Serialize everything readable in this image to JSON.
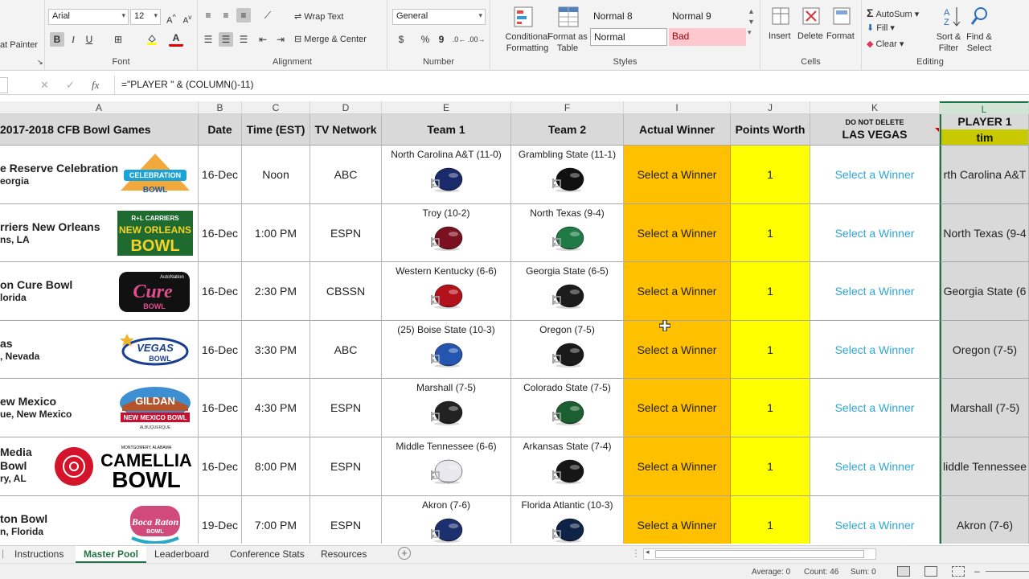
{
  "ribbon": {
    "clipboard": {
      "format_painter": "at Painter"
    },
    "font": {
      "name": "Arial",
      "size": "12",
      "group_label": "Font",
      "bold": "B",
      "italic": "I",
      "underline": "U",
      "font_color_letter": "A"
    },
    "alignment": {
      "wrap_text": "Wrap Text",
      "merge_center": "Merge & Center",
      "group_label": "Alignment"
    },
    "number": {
      "format": "General",
      "currency": "$",
      "percent": "%",
      "comma": "9",
      "group_label": "Number"
    },
    "styles": {
      "conditional_formatting": "Conditional Formatting",
      "format_as_table": "Format as Table",
      "cells": [
        "Normal 8",
        "Normal 9",
        "Normal",
        "Bad"
      ],
      "group_label": "Styles"
    },
    "cells": {
      "insert": "Insert",
      "delete": "Delete",
      "format": "Format",
      "group_label": "Cells"
    },
    "editing": {
      "autosum": "AutoSum",
      "fill": "Fill",
      "clear": "Clear",
      "sort_filter": "Sort & Filter",
      "find_select": "Find & Select",
      "group_label": "Editing"
    }
  },
  "formula_bar": {
    "fx": "fx",
    "formula": "=\"PLAYER \" & (COLUMN()-11)"
  },
  "columns": [
    "A",
    "B",
    "C",
    "D",
    "E",
    "F",
    "I",
    "J",
    "K",
    "L"
  ],
  "header": {
    "a": "2017-2018 CFB Bowl Games",
    "b": "Date",
    "c": "Time (EST)",
    "d": "TV Network",
    "e": "Team 1",
    "f": "Team 2",
    "i": "Actual Winner",
    "j": "Points Worth",
    "k_small": "DO NOT DELETE",
    "k": "LAS VEGAS",
    "l": "PLAYER 1",
    "l_sub": "tim"
  },
  "rows": [
    {
      "bowl": "e Reserve Celebration",
      "bowl2": "",
      "loc": "eorgia",
      "date": "16-Dec",
      "time": "Noon",
      "tv": "ABC",
      "team1": "North Carolina A&T (11-0)",
      "team2": "Grambling State (11-1)",
      "winner": "Select a Winner",
      "points": "1",
      "vegas": "Select a Winner",
      "player": "rth Carolina A&T"
    },
    {
      "bowl": "rriers New Orleans",
      "bowl2": "",
      "loc": "ns, LA",
      "date": "16-Dec",
      "time": "1:00 PM",
      "tv": "ESPN",
      "team1": "Troy (10-2)",
      "team2": "North Texas (9-4)",
      "winner": "Select a Winner",
      "points": "1",
      "vegas": "Select a Winner",
      "player": "North Texas (9-4"
    },
    {
      "bowl": "on Cure Bowl",
      "bowl2": "",
      "loc": "lorida",
      "date": "16-Dec",
      "time": "2:30 PM",
      "tv": "CBSSN",
      "team1": "Western Kentucky (6-6)",
      "team2": "Georgia State (6-5)",
      "winner": "Select a Winner",
      "points": "1",
      "vegas": "Select a Winner",
      "player": "Georgia State (6"
    },
    {
      "bowl": "as",
      "bowl2": "",
      "loc": ", Nevada",
      "date": "16-Dec",
      "time": "3:30 PM",
      "tv": "ABC",
      "team1": "(25) Boise State (10-3)",
      "team2": "Oregon (7-5)",
      "winner": "Select a Winner",
      "points": "1",
      "vegas": "Select a Winner",
      "player": "Oregon (7-5)"
    },
    {
      "bowl": "ew Mexico",
      "bowl2": "",
      "loc": "ue, New Mexico",
      "date": "16-Dec",
      "time": "4:30 PM",
      "tv": "ESPN",
      "team1": "Marshall (7-5)",
      "team2": "Colorado State (7-5)",
      "winner": "Select a Winner",
      "points": "1",
      "vegas": "Select a Winner",
      "player": "Marshall (7-5)"
    },
    {
      "bowl": "Media",
      "bowl2": "Bowl",
      "loc": "ry, AL",
      "date": "16-Dec",
      "time": "8:00 PM",
      "tv": "ESPN",
      "team1": "Middle Tennessee (6-6)",
      "team2": "Arkansas State (7-4)",
      "winner": "Select a Winner",
      "points": "1",
      "vegas": "Select a Winner",
      "player": "liddle Tennessee"
    },
    {
      "bowl": "ton Bowl",
      "bowl2": "",
      "loc": "n, Florida",
      "date": "19-Dec",
      "time": "7:00 PM",
      "tv": "ESPN",
      "team1": "Akron (7-6)",
      "team2": "Florida Atlantic (10-3)",
      "winner": "Select a Winner",
      "points": "1",
      "vegas": "Select a Winner",
      "player": "Akron (7-6)"
    }
  ],
  "logos": [
    {
      "text1": "CELEBRATION",
      "text2": "BOWL"
    },
    {
      "text1": "R+L CARRIERS",
      "text2": "NEW ORLEANS",
      "text3": "BOWL"
    },
    {
      "text1": "AutoNation",
      "text2": "Cure",
      "text3": "BOWL"
    },
    {
      "text1": "VEGAS",
      "text2": "BOWL"
    },
    {
      "text1": "GILDAN",
      "text2": "NEW MEXICO BOWL",
      "text3": "ALBUQUERQUE"
    },
    {
      "text1": "MONTGOMERY, ALABAMA",
      "text2": "CAMELLIA",
      "text3": "BOWL"
    },
    {
      "text1": "Boca Raton",
      "text2": "BOWL"
    }
  ],
  "helmets": [
    [
      "#1b2a6b",
      "#111111"
    ],
    [
      "#7a1020",
      "#1f7a45"
    ],
    [
      "#b3121c",
      "#1c1c1c"
    ],
    [
      "#2456b0",
      "#1a1a1a"
    ],
    [
      "#222222",
      "#1b5e2f"
    ],
    [
      "#e8e8ee",
      "#161616"
    ],
    [
      "#1c2f6e",
      "#0f2247"
    ]
  ],
  "sheet_tabs": [
    "Instructions",
    "Master Pool",
    "Leaderboard",
    "Conference Stats",
    "Resources"
  ],
  "status": {
    "average": "Average: 0",
    "count": "Count: 46",
    "sum": "Sum: 0"
  },
  "colors": {
    "winner_bg": "#ffc000",
    "points_bg": "#ffff00",
    "vegas_text": "#2fa6d4",
    "player_header": "#d9d9d9",
    "player_sub_bg": "#c9c900",
    "player_col_bg": "#d9d9d9",
    "accent": "#217346"
  }
}
